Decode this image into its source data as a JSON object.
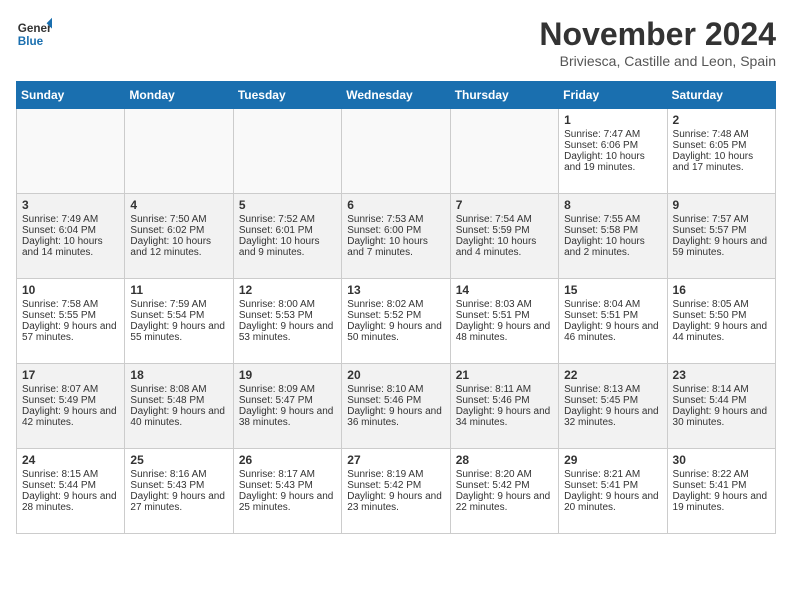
{
  "header": {
    "logo_line1": "General",
    "logo_line2": "Blue",
    "month_title": "November 2024",
    "subtitle": "Briviesca, Castille and Leon, Spain"
  },
  "weekdays": [
    "Sunday",
    "Monday",
    "Tuesday",
    "Wednesday",
    "Thursday",
    "Friday",
    "Saturday"
  ],
  "weeks": [
    [
      {
        "day": "",
        "info": ""
      },
      {
        "day": "",
        "info": ""
      },
      {
        "day": "",
        "info": ""
      },
      {
        "day": "",
        "info": ""
      },
      {
        "day": "",
        "info": ""
      },
      {
        "day": "1",
        "info": "Sunrise: 7:47 AM\nSunset: 6:06 PM\nDaylight: 10 hours and 19 minutes."
      },
      {
        "day": "2",
        "info": "Sunrise: 7:48 AM\nSunset: 6:05 PM\nDaylight: 10 hours and 17 minutes."
      }
    ],
    [
      {
        "day": "3",
        "info": "Sunrise: 7:49 AM\nSunset: 6:04 PM\nDaylight: 10 hours and 14 minutes."
      },
      {
        "day": "4",
        "info": "Sunrise: 7:50 AM\nSunset: 6:02 PM\nDaylight: 10 hours and 12 minutes."
      },
      {
        "day": "5",
        "info": "Sunrise: 7:52 AM\nSunset: 6:01 PM\nDaylight: 10 hours and 9 minutes."
      },
      {
        "day": "6",
        "info": "Sunrise: 7:53 AM\nSunset: 6:00 PM\nDaylight: 10 hours and 7 minutes."
      },
      {
        "day": "7",
        "info": "Sunrise: 7:54 AM\nSunset: 5:59 PM\nDaylight: 10 hours and 4 minutes."
      },
      {
        "day": "8",
        "info": "Sunrise: 7:55 AM\nSunset: 5:58 PM\nDaylight: 10 hours and 2 minutes."
      },
      {
        "day": "9",
        "info": "Sunrise: 7:57 AM\nSunset: 5:57 PM\nDaylight: 9 hours and 59 minutes."
      }
    ],
    [
      {
        "day": "10",
        "info": "Sunrise: 7:58 AM\nSunset: 5:55 PM\nDaylight: 9 hours and 57 minutes."
      },
      {
        "day": "11",
        "info": "Sunrise: 7:59 AM\nSunset: 5:54 PM\nDaylight: 9 hours and 55 minutes."
      },
      {
        "day": "12",
        "info": "Sunrise: 8:00 AM\nSunset: 5:53 PM\nDaylight: 9 hours and 53 minutes."
      },
      {
        "day": "13",
        "info": "Sunrise: 8:02 AM\nSunset: 5:52 PM\nDaylight: 9 hours and 50 minutes."
      },
      {
        "day": "14",
        "info": "Sunrise: 8:03 AM\nSunset: 5:51 PM\nDaylight: 9 hours and 48 minutes."
      },
      {
        "day": "15",
        "info": "Sunrise: 8:04 AM\nSunset: 5:51 PM\nDaylight: 9 hours and 46 minutes."
      },
      {
        "day": "16",
        "info": "Sunrise: 8:05 AM\nSunset: 5:50 PM\nDaylight: 9 hours and 44 minutes."
      }
    ],
    [
      {
        "day": "17",
        "info": "Sunrise: 8:07 AM\nSunset: 5:49 PM\nDaylight: 9 hours and 42 minutes."
      },
      {
        "day": "18",
        "info": "Sunrise: 8:08 AM\nSunset: 5:48 PM\nDaylight: 9 hours and 40 minutes."
      },
      {
        "day": "19",
        "info": "Sunrise: 8:09 AM\nSunset: 5:47 PM\nDaylight: 9 hours and 38 minutes."
      },
      {
        "day": "20",
        "info": "Sunrise: 8:10 AM\nSunset: 5:46 PM\nDaylight: 9 hours and 36 minutes."
      },
      {
        "day": "21",
        "info": "Sunrise: 8:11 AM\nSunset: 5:46 PM\nDaylight: 9 hours and 34 minutes."
      },
      {
        "day": "22",
        "info": "Sunrise: 8:13 AM\nSunset: 5:45 PM\nDaylight: 9 hours and 32 minutes."
      },
      {
        "day": "23",
        "info": "Sunrise: 8:14 AM\nSunset: 5:44 PM\nDaylight: 9 hours and 30 minutes."
      }
    ],
    [
      {
        "day": "24",
        "info": "Sunrise: 8:15 AM\nSunset: 5:44 PM\nDaylight: 9 hours and 28 minutes."
      },
      {
        "day": "25",
        "info": "Sunrise: 8:16 AM\nSunset: 5:43 PM\nDaylight: 9 hours and 27 minutes."
      },
      {
        "day": "26",
        "info": "Sunrise: 8:17 AM\nSunset: 5:43 PM\nDaylight: 9 hours and 25 minutes."
      },
      {
        "day": "27",
        "info": "Sunrise: 8:19 AM\nSunset: 5:42 PM\nDaylight: 9 hours and 23 minutes."
      },
      {
        "day": "28",
        "info": "Sunrise: 8:20 AM\nSunset: 5:42 PM\nDaylight: 9 hours and 22 minutes."
      },
      {
        "day": "29",
        "info": "Sunrise: 8:21 AM\nSunset: 5:41 PM\nDaylight: 9 hours and 20 minutes."
      },
      {
        "day": "30",
        "info": "Sunrise: 8:22 AM\nSunset: 5:41 PM\nDaylight: 9 hours and 19 minutes."
      }
    ]
  ]
}
